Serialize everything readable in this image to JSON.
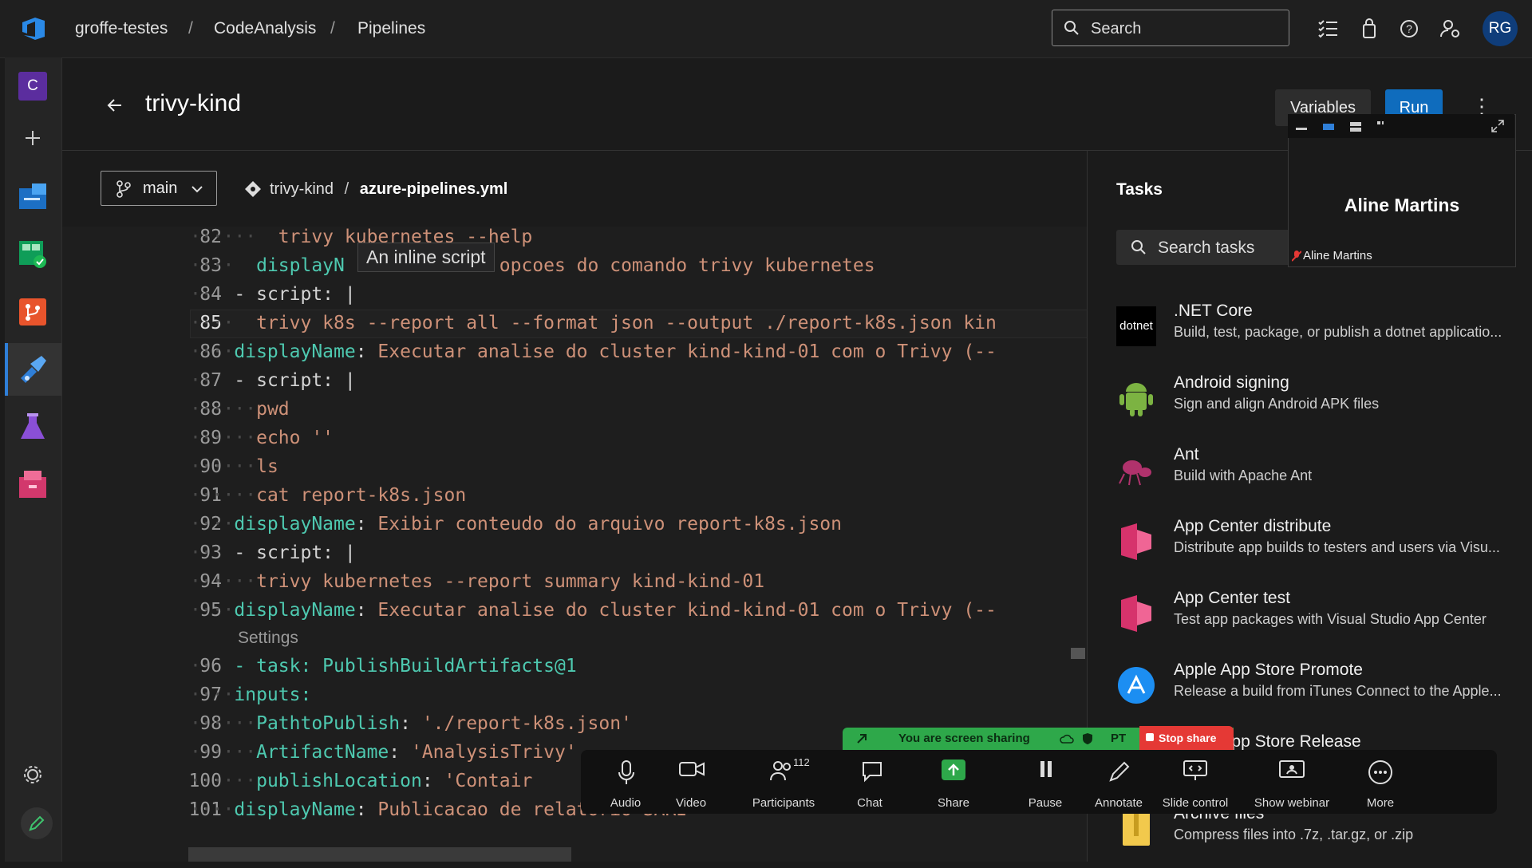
{
  "breadcrumb": {
    "org": "groffe-testes",
    "project": "CodeAnalysis",
    "section": "Pipelines",
    "separator": "/"
  },
  "top_search": {
    "label": "Search"
  },
  "user": {
    "initials": "RG"
  },
  "nav": {
    "project_initial": "C"
  },
  "page": {
    "title": "trivy-kind",
    "variables_label": "Variables",
    "run_label": "Run"
  },
  "editor_toolbar": {
    "branch": "main",
    "repo": "trivy-kind",
    "sep": "/",
    "file": "azure-pipelines.yml"
  },
  "editor": {
    "tooltip": "An inline script",
    "settings_label": "Settings",
    "lines": [
      {
        "n": "82",
        "text": "trivy kubernetes --help"
      },
      {
        "n": "83",
        "key": "displayN",
        "text": "opcoes do comando trivy kubernetes"
      },
      {
        "n": "84",
        "text": "- script: |"
      },
      {
        "n": "85",
        "text": "trivy k8s --report all --format json --output ./report-k8s.json kin"
      },
      {
        "n": "86",
        "key": "displayName",
        "text": "Executar analise do cluster kind-kind-01 com o Trivy (--"
      },
      {
        "n": "87",
        "text": "- script: |"
      },
      {
        "n": "88",
        "text": "pwd"
      },
      {
        "n": "89",
        "text": "echo ''"
      },
      {
        "n": "90",
        "text": "ls"
      },
      {
        "n": "91",
        "text": "cat report-k8s.json"
      },
      {
        "n": "92",
        "key": "displayName",
        "text": "Exibir conteudo do arquivo report-k8s.json"
      },
      {
        "n": "93",
        "text": "- script: |"
      },
      {
        "n": "94",
        "text": "trivy kubernetes --report summary kind-kind-01"
      },
      {
        "n": "95",
        "key": "displayName",
        "text": "Executar analise do cluster kind-kind-01 com o Trivy (--"
      },
      {
        "n": "96",
        "text": "- task: PublishBuildArtifacts@1"
      },
      {
        "n": "97",
        "text": "inputs:"
      },
      {
        "n": "98",
        "key": "PathtoPublish",
        "text": "'./report-k8s.json'"
      },
      {
        "n": "99",
        "key": "ArtifactName",
        "text": "'AnalysisTrivy'"
      },
      {
        "n": "100",
        "key": "publishLocation",
        "text": "'Contair"
      },
      {
        "n": "101",
        "key": "displayName",
        "text": "Publicacao de relatorio SARI"
      }
    ]
  },
  "tasks": {
    "title": "Tasks",
    "search_placeholder": "Search tasks",
    "items": [
      {
        "name": ".NET Core",
        "desc": "Build, test, package, or publish a dotnet applicatio...",
        "icon": "dotnet-icon"
      },
      {
        "name": "Android signing",
        "desc": "Sign and align Android APK files",
        "icon": "android-icon"
      },
      {
        "name": "Ant",
        "desc": "Build with Apache Ant",
        "icon": "ant-icon"
      },
      {
        "name": "App Center distribute",
        "desc": "Distribute app builds to testers and users via Visu...",
        "icon": "app-center-icon"
      },
      {
        "name": "App Center test",
        "desc": "Test app packages with Visual Studio App Center",
        "icon": "app-center-icon"
      },
      {
        "name": "Apple App Store Promote",
        "desc": "Release a build from iTunes Connect to the Apple...",
        "icon": "app-store-icon"
      },
      {
        "name": "Apple App Store Release",
        "desc": "",
        "icon": "app-store-icon"
      },
      {
        "name": "Archive files",
        "desc": "Compress files into .7z, .tar.gz, or .zip",
        "icon": "archive-icon"
      }
    ]
  },
  "meeting": {
    "video_name": "Aline Martins",
    "video_small_name": "Aline Martins",
    "sharing_text": "You are screen sharing",
    "lang": "PT",
    "stop_share": "Stop share",
    "participants_count": "112",
    "buttons": [
      "Audio",
      "Video",
      "Participants",
      "Chat",
      "Share",
      "Pause",
      "Annotate",
      "Slide control",
      "Show webinar",
      "More"
    ]
  }
}
